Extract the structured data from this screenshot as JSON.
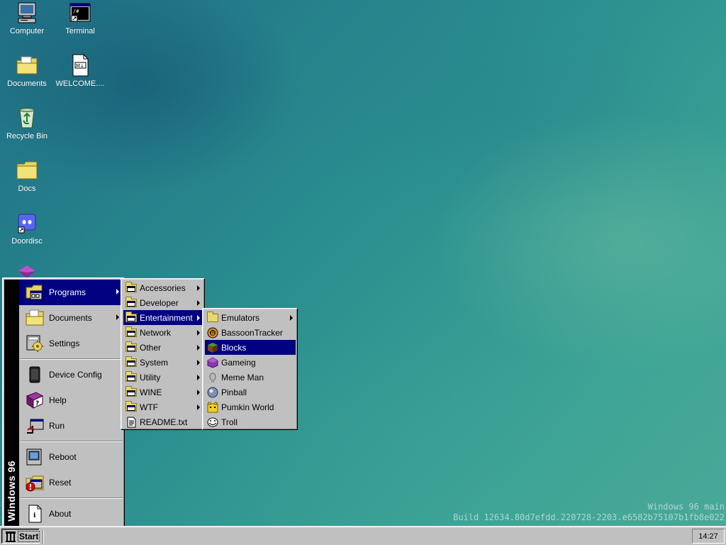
{
  "desktop": {
    "icons": [
      {
        "label": "Computer",
        "icon": "computer-icon"
      },
      {
        "label": "Terminal",
        "icon": "terminal-icon"
      },
      {
        "label": "Documents",
        "icon": "documents-folder-icon"
      },
      {
        "label": "WELCOME....",
        "icon": "markdown-file-icon"
      },
      {
        "label": "Recycle Bin",
        "icon": "recycle-bin-icon"
      },
      {
        "label": "Docs",
        "icon": "folder-icon"
      },
      {
        "label": "Doordisc",
        "icon": "doordisc-icon"
      }
    ]
  },
  "start_menu": {
    "banner": "Windows 96",
    "items": [
      {
        "label": "Programs",
        "icon": "programs-icon",
        "submenu": true,
        "highlighted": true
      },
      {
        "label": "Documents",
        "icon": "documents-icon",
        "submenu": true
      },
      {
        "label": "Settings",
        "icon": "settings-icon"
      },
      {
        "label": "Device Config",
        "icon": "device-config-icon"
      },
      {
        "label": "Help",
        "icon": "help-book-icon"
      },
      {
        "label": "Run",
        "icon": "run-icon"
      },
      {
        "label": "Reboot",
        "icon": "reboot-icon"
      },
      {
        "label": "Reset",
        "icon": "reset-icon"
      },
      {
        "label": "About",
        "icon": "about-icon"
      }
    ]
  },
  "programs_menu": {
    "items": [
      {
        "label": "Accessories",
        "submenu": true
      },
      {
        "label": "Developer",
        "submenu": true
      },
      {
        "label": "Entertainment",
        "submenu": true,
        "highlighted": true
      },
      {
        "label": "Network",
        "submenu": true
      },
      {
        "label": "Other",
        "submenu": true
      },
      {
        "label": "System",
        "submenu": true
      },
      {
        "label": "Utility",
        "submenu": true
      },
      {
        "label": "WINE",
        "submenu": true
      },
      {
        "label": "WTF",
        "submenu": true
      },
      {
        "label": "README.txt",
        "submenu": false
      }
    ]
  },
  "entertainment_menu": {
    "items": [
      {
        "label": "Emulators",
        "icon": "folder-icon",
        "submenu": true
      },
      {
        "label": "BassoonTracker",
        "icon": "bassoontracker-icon"
      },
      {
        "label": "Blocks",
        "icon": "blocks-icon",
        "highlighted": true
      },
      {
        "label": "Gameing",
        "icon": "gameing-icon"
      },
      {
        "label": "Meme Man",
        "icon": "meme-man-icon"
      },
      {
        "label": "Pinball",
        "icon": "pinball-icon"
      },
      {
        "label": "Pumkin World",
        "icon": "pumkin-world-icon"
      },
      {
        "label": "Troll",
        "icon": "troll-icon"
      }
    ]
  },
  "taskbar": {
    "start_label": "Start",
    "clock": "14:27"
  },
  "watermark": {
    "line1": "Windows 96 main",
    "line2": "Build 12634.80d7efdd.220728-2203.e6582b75107b1fb8e022"
  },
  "colors": {
    "highlight": "#000080",
    "face": "#c0c0c0",
    "desktop": "#2a8a8e"
  }
}
